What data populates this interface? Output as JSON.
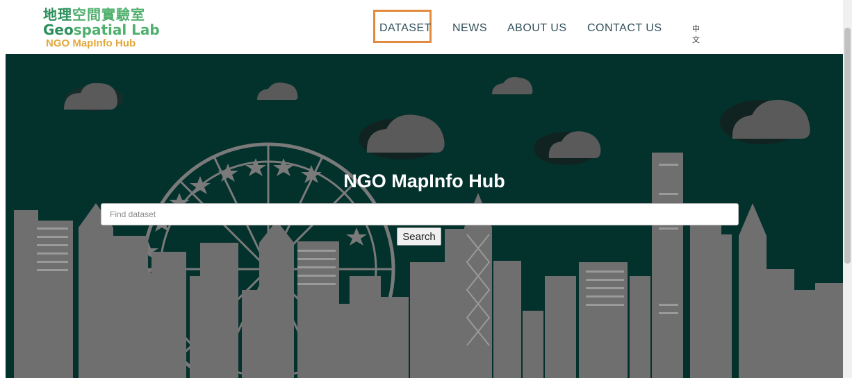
{
  "logo": {
    "zh_part1": "地理",
    "zh_part2": "空間實驗室",
    "en_part1": "Geo",
    "en_part2": "spatial Lab",
    "hub": "NGO MapInfo Hub"
  },
  "nav": {
    "items": [
      {
        "label": "DATASET",
        "highlighted": true
      },
      {
        "label": "NEWS"
      },
      {
        "label": "ABOUT US"
      },
      {
        "label": "CONTACT US"
      }
    ],
    "language": "中文"
  },
  "hero": {
    "title": "NGO MapInfo Hub",
    "search_placeholder": "Find dataset",
    "search_button": "Search"
  },
  "colors": {
    "hero_bg": "#03312c",
    "skyline": "#6f6f6f",
    "highlight": "#e48a3c",
    "nav_text": "#2f4f5a"
  }
}
